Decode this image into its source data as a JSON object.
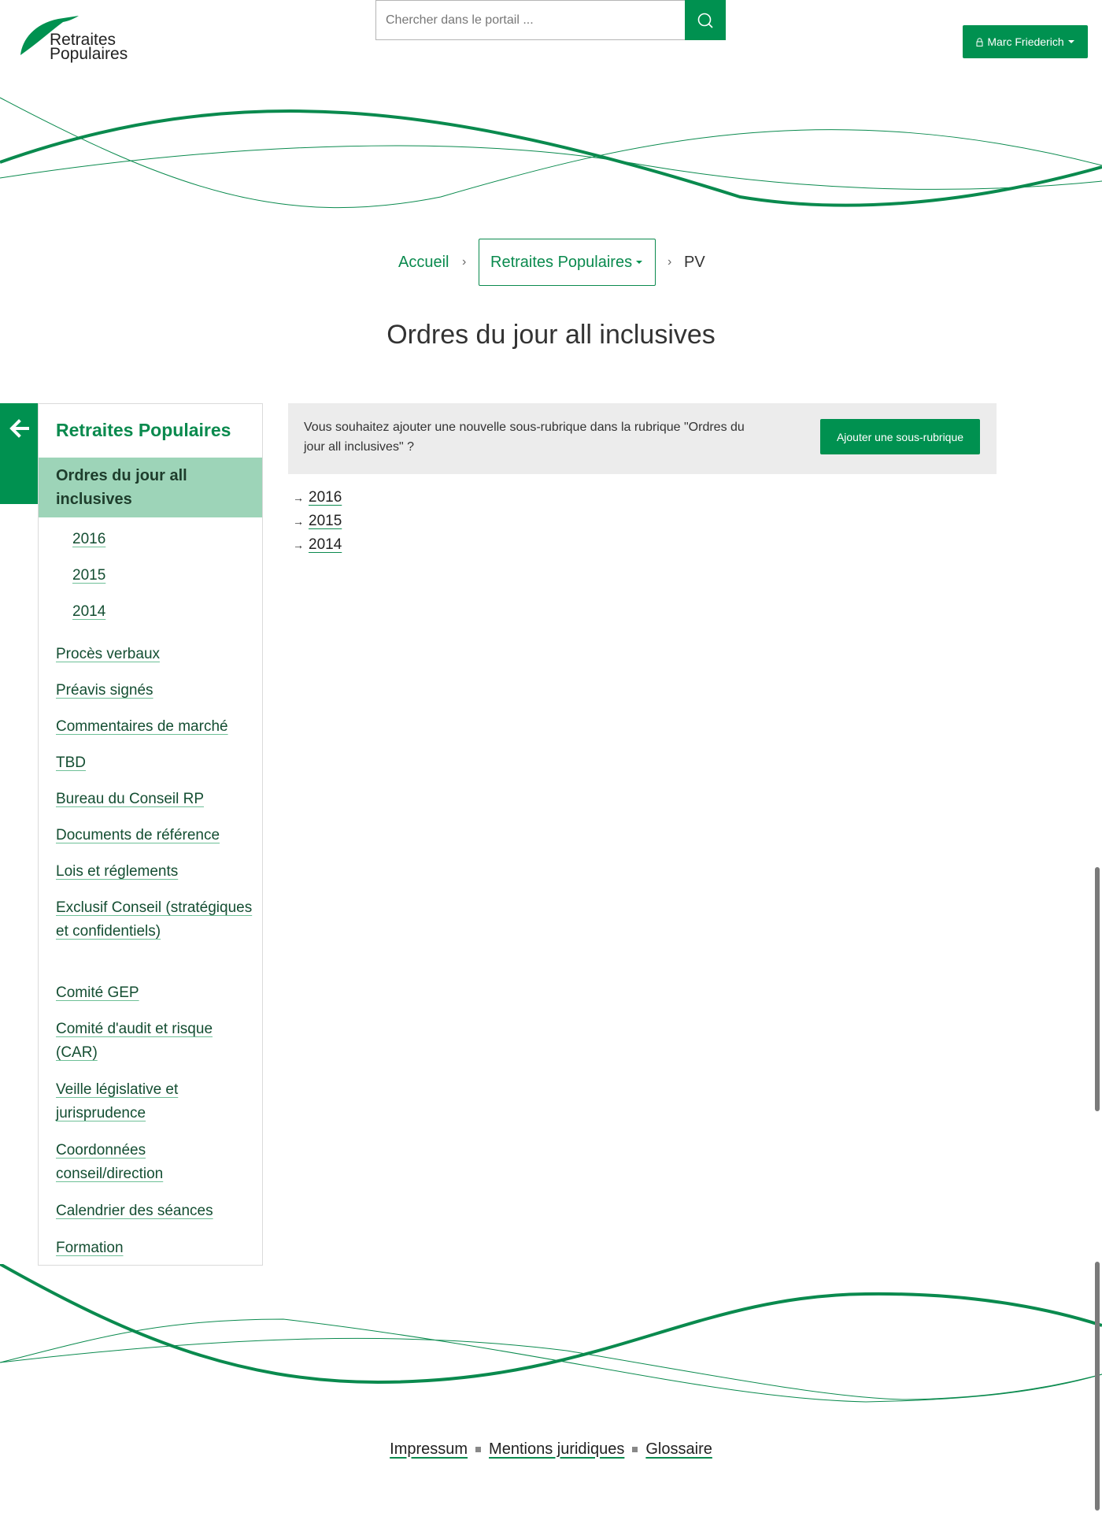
{
  "brand": {
    "logo_line1": "Retraites",
    "logo_line2": "Populaires",
    "green": "#009150",
    "light_green": "#9dd4b8"
  },
  "header": {
    "search_placeholder": "Chercher dans le portail ...",
    "search_icon": "search-icon",
    "user_icon": "lock-icon",
    "user_name": "Marc Friederich"
  },
  "breadcrumb": {
    "home": "Accueil",
    "section": "Retraites Populaires",
    "current": "PV",
    "separator": "›"
  },
  "page": {
    "title": "Ordres du jour all inclusives"
  },
  "sidebar": {
    "back_icon": "arrow-left-icon",
    "title": "Retraites Populaires",
    "active": "Ordres du jour all inclusives",
    "sub_items": [
      "2016",
      "2015",
      "2014"
    ],
    "items": [
      "Procès verbaux",
      "Préavis signés",
      "Commentaires de marché",
      "TBD",
      "Bureau du Conseil RP",
      "Documents de référence",
      "Lois et réglements",
      "Exclusif Conseil (stratégiques et confidentiels)",
      "Comité GEP",
      "Comité d'audit et risque (CAR)",
      "Veille législative et jurisprudence",
      "Coordonnées conseil/direction",
      "Calendrier des séances",
      "Formation"
    ]
  },
  "notice": {
    "text": "Vous souhaitez ajouter une nouvelle sous-rubrique dans la rubrique \"Ordres du jour all inclusives\" ?",
    "button": "Ajouter une sous-rubrique"
  },
  "content": {
    "arrow": "→",
    "years": [
      "2016",
      "2015",
      "2014"
    ]
  },
  "footer": {
    "links": [
      "Impressum",
      "Mentions juridiques",
      "Glossaire"
    ]
  }
}
